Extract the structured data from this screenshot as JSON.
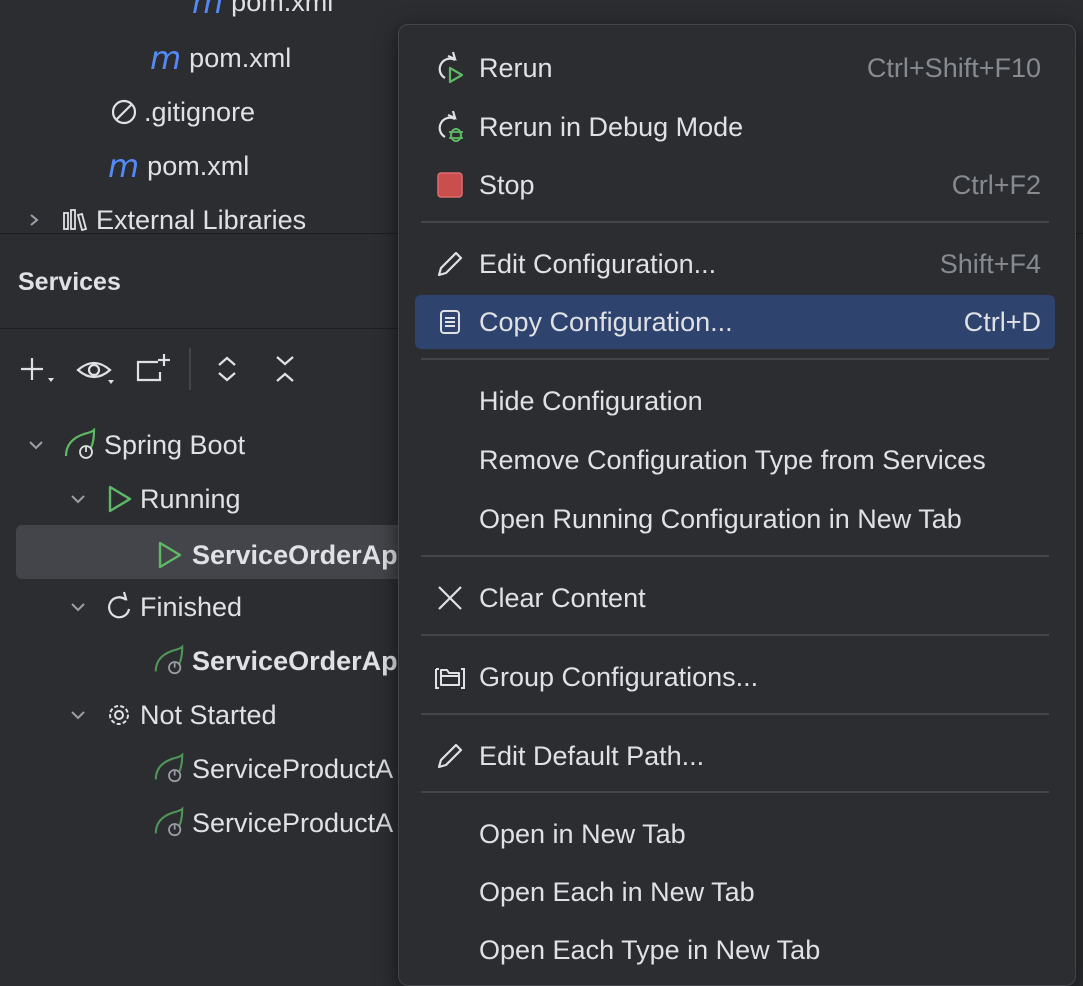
{
  "project_tree": {
    "items": [
      {
        "label": "pom.xml",
        "icon": "maven-icon"
      },
      {
        "label": "pom.xml",
        "icon": "maven-icon"
      },
      {
        "label": ".gitignore",
        "icon": "ignored-icon"
      },
      {
        "label": "pom.xml",
        "icon": "maven-icon"
      },
      {
        "label": "External Libraries",
        "icon": "library-icon"
      }
    ],
    "maven_glyph": "m"
  },
  "services": {
    "title": "Services",
    "toolbar": [
      "add-icon",
      "eye-icon",
      "new-group-icon",
      "expand-all-icon",
      "collapse-all-icon"
    ],
    "tree": {
      "spring_boot": "Spring Boot",
      "running": "Running",
      "running_item": "ServiceOrderAp",
      "finished": "Finished",
      "finished_item": "ServiceOrderAp",
      "not_started": "Not Started",
      "not_started_items": [
        "ServiceProductA",
        "ServiceProductA"
      ]
    }
  },
  "context_menu": {
    "items": [
      {
        "label": "Rerun",
        "shortcut": "Ctrl+Shift+F10",
        "icon": "rerun-icon"
      },
      {
        "label": "Rerun in Debug Mode",
        "shortcut": "",
        "icon": "rerun-debug-icon"
      },
      {
        "label": "Stop",
        "shortcut": "Ctrl+F2",
        "icon": "stop-icon"
      },
      {
        "label": "Edit Configuration...",
        "shortcut": "Shift+F4",
        "icon": "pencil-icon"
      },
      {
        "label": "Copy Configuration...",
        "shortcut": "Ctrl+D",
        "icon": "copy-icon",
        "selected": true
      },
      {
        "label": "Hide Configuration",
        "shortcut": ""
      },
      {
        "label": "Remove Configuration Type from Services",
        "shortcut": ""
      },
      {
        "label": "Open Running Configuration in New Tab",
        "shortcut": ""
      },
      {
        "label": "Clear Content",
        "shortcut": "",
        "icon": "close-icon"
      },
      {
        "label": "Group Configurations...",
        "shortcut": "",
        "icon": "folder-group-icon"
      },
      {
        "label": "Edit Default Path...",
        "shortcut": "",
        "icon": "pencil-icon"
      },
      {
        "label": "Open in New Tab",
        "shortcut": ""
      },
      {
        "label": "Open Each in New Tab",
        "shortcut": ""
      },
      {
        "label": "Open Each Type in New Tab",
        "shortcut": ""
      }
    ]
  },
  "colors": {
    "background": "#2b2d30",
    "selection": "#2e436e",
    "tree_selection": "#43454a",
    "maven_blue": "#548af7",
    "run_green": "#5fb865",
    "stop_red": "#c94f4f"
  }
}
